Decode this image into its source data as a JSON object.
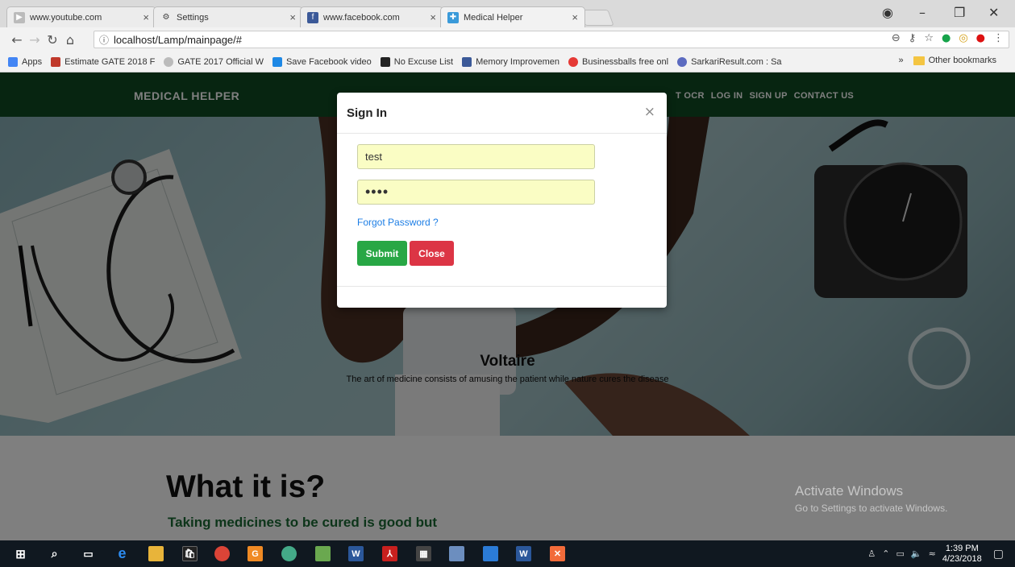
{
  "browser": {
    "tabs": [
      {
        "title": "www.youtube.com",
        "icon": "youtube-icon",
        "color": "#aaaaaa"
      },
      {
        "title": "Settings",
        "icon": "gear-icon",
        "color": "#555555"
      },
      {
        "title": "www.facebook.com",
        "icon": "facebook-icon",
        "color": "#3b5998"
      },
      {
        "title": "Medical Helper",
        "icon": "medical-favicon",
        "color": "#3a9ad9"
      }
    ],
    "url": "localhost/Lamp/mainpage/#",
    "bookmarks": [
      {
        "label": "Apps",
        "color": "#4285f4"
      },
      {
        "label": "Estimate GATE 2018 F",
        "color": "#c0392b"
      },
      {
        "label": "GATE 2017 Official W",
        "color": "#bbbbbb"
      },
      {
        "label": "Save Facebook video",
        "color": "#1e88e5"
      },
      {
        "label": "No Excuse List",
        "color": "#222222"
      },
      {
        "label": "Memory Improvemen",
        "color": "#3b5998"
      },
      {
        "label": "Businessballs free onl",
        "color": "#e53935"
      },
      {
        "label": "SarkariResult.com : Sa",
        "color": "#5c6bc0"
      }
    ],
    "bookmarks_more": "»",
    "other_bookmarks": "Other bookmarks"
  },
  "site": {
    "brand": "MEDICAL HELPER",
    "nav": [
      "T OCR",
      "LOG IN",
      "SIGN UP",
      "CONTACT US"
    ],
    "hero_title": "Voltaire",
    "hero_quote": "The art of medicine consists of amusing the patient while nature cures the disease",
    "section_heading": "What it is?",
    "section_sub": "Taking medicines to be cured is good but"
  },
  "modal": {
    "title": "Sign In",
    "close": "×",
    "username_value": "test",
    "password_value": "••••",
    "forgot": "Forgot Password ?",
    "submit": "Submit",
    "close_button": "Close"
  },
  "watermark": {
    "line1": "Activate Windows",
    "line2": "Go to Settings to activate Windows."
  },
  "taskbar": {
    "time": "1:39 PM",
    "date": "4/23/2018"
  }
}
